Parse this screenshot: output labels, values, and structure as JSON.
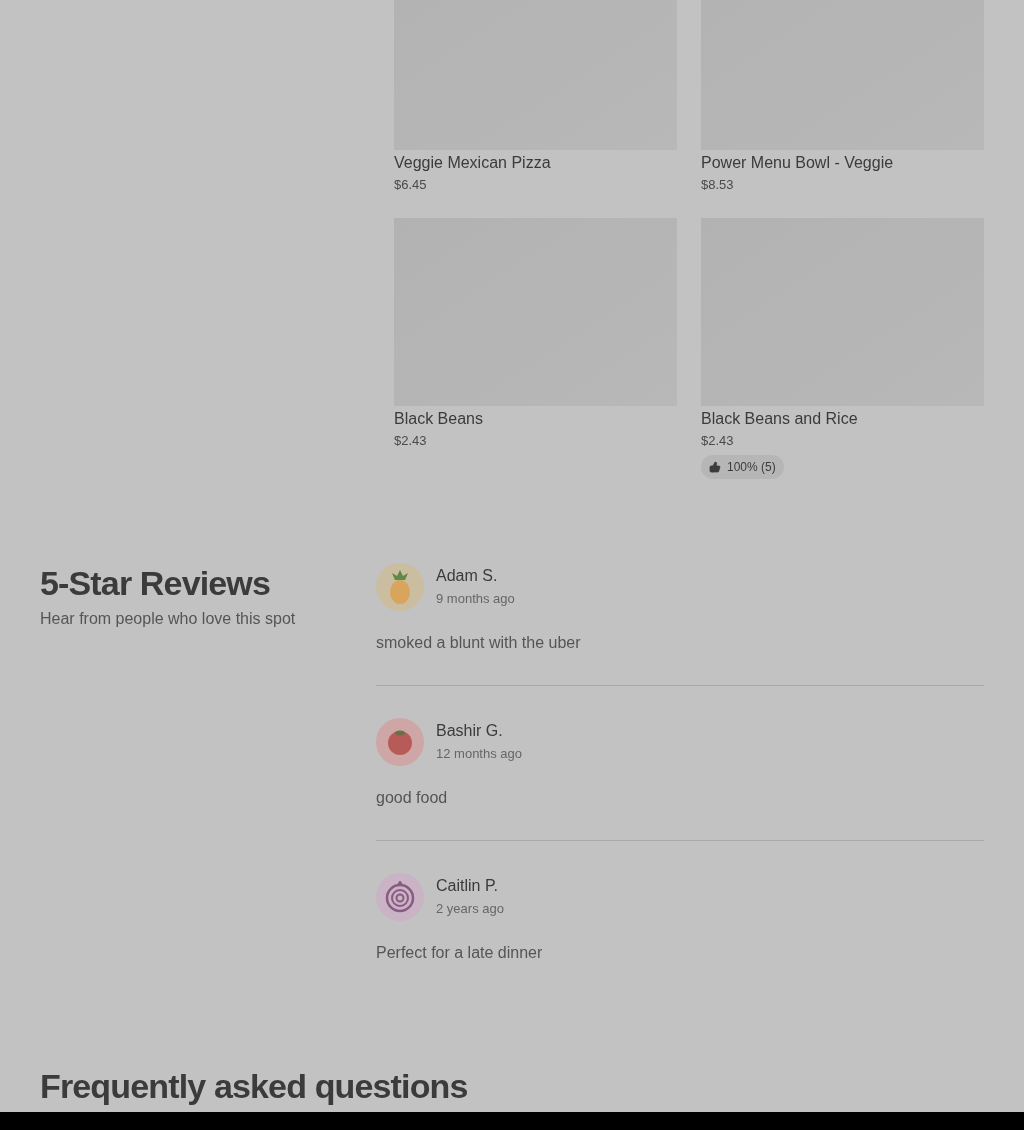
{
  "menu_items": [
    {
      "name": "Veggie Mexican Pizza",
      "price": "$6.45"
    },
    {
      "name": "Power Menu Bowl - Veggie",
      "price": "$8.53"
    },
    {
      "name": "Black Beans",
      "price": "$2.43"
    },
    {
      "name": "Black Beans and Rice",
      "price": "$2.43",
      "rating": "100% (5)"
    }
  ],
  "reviews_section": {
    "title": "5-Star Reviews",
    "subtitle": "Hear from people who love this spot"
  },
  "reviews": [
    {
      "name": "Adam S.",
      "time": "9 months ago",
      "text": "smoked a blunt with the uber",
      "avatar": {
        "kind": "pineapple"
      }
    },
    {
      "name": "Bashir G.",
      "time": "12 months ago",
      "text": "good food",
      "avatar": {
        "kind": "tomato"
      }
    },
    {
      "name": "Caitlin P.",
      "time": "2 years ago",
      "text": "Perfect for a late dinner",
      "avatar": {
        "kind": "onion"
      }
    }
  ],
  "faq": {
    "title": "Frequently asked questions"
  }
}
